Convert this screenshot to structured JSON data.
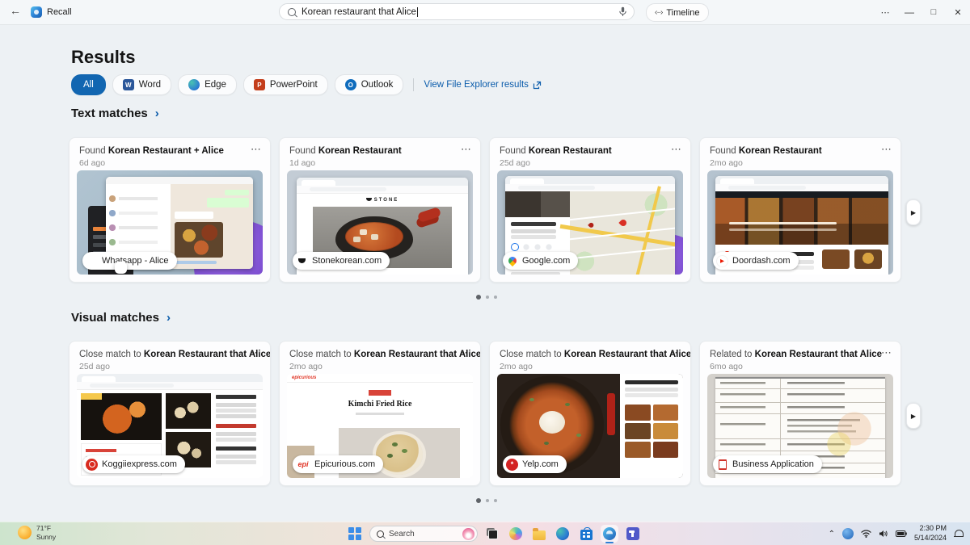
{
  "titlebar": {
    "app_name": "Recall",
    "search_value": "Korean restaurant that Alice",
    "timeline_label": "Timeline"
  },
  "results": {
    "heading": "Results",
    "filters": [
      "All",
      "Word",
      "Edge",
      "PowerPoint",
      "Outlook"
    ],
    "file_explorer_link": "View File Explorer results"
  },
  "sections": {
    "text": {
      "title": "Text matches",
      "cards": [
        {
          "prefix": "Found",
          "title": "Korean Restaurant + Alice",
          "time": "6d ago",
          "badge": "Whatsapp - Alice"
        },
        {
          "prefix": "Found",
          "title": "Korean Restaurant",
          "time": "1d ago",
          "badge": "Stonekorean.com"
        },
        {
          "prefix": "Found",
          "title": "Korean Restaurant",
          "time": "25d ago",
          "badge": "Google.com"
        },
        {
          "prefix": "Found",
          "title": "Korean Restaurant",
          "time": "2mo ago",
          "badge": "Doordash.com"
        }
      ]
    },
    "visual": {
      "title": "Visual matches",
      "cards": [
        {
          "prefix": "Close match to",
          "title": "Korean Restaurant that Alice",
          "time": "25d ago",
          "badge": "Koggiiexpress.com"
        },
        {
          "prefix": "Close match to",
          "title": "Korean Restaurant that Alice",
          "time": "2mo ago",
          "badge": "Epicurious.com"
        },
        {
          "prefix": "Close match to",
          "title": "Korean Restaurant that Alice",
          "time": "2mo ago",
          "badge": "Yelp.com"
        },
        {
          "prefix": "Related to",
          "title": "Korean Restaurant that Alice",
          "time": "6mo ago",
          "badge": "Business Application"
        }
      ]
    }
  },
  "thumbs": {
    "stone_logo": "STONE",
    "epicurious_logo": "epicurious",
    "epicurious_title": "Kimchi Fried Rice",
    "epi_badge": "epi"
  },
  "taskbar": {
    "weather_temp": "71°F",
    "weather_cond": "Sunny",
    "search_placeholder": "Search",
    "time": "2:30 PM",
    "date": "5/14/2024"
  },
  "colors": {
    "accent": "#1266b1",
    "link": "#0b5cab"
  }
}
